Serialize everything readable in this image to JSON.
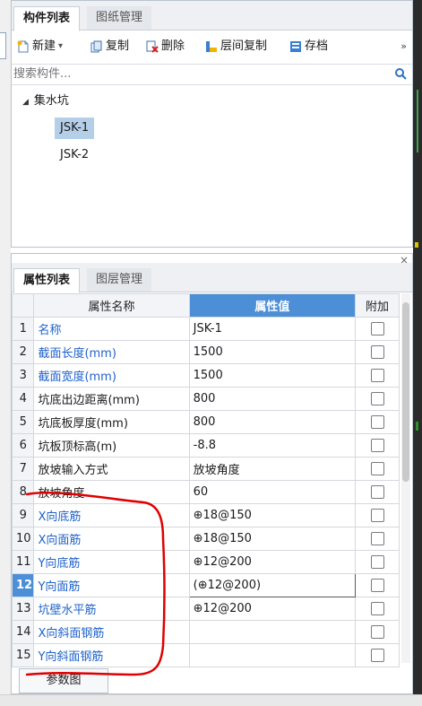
{
  "component_panel": {
    "tabs": [
      {
        "label": "构件列表",
        "active": true
      },
      {
        "label": "图纸管理",
        "active": false
      }
    ],
    "close_glyph": "×",
    "toolbar": {
      "new_label": "新建",
      "new_dropdown_glyph": "▾",
      "copy_label": "复制",
      "delete_label": "删除",
      "floor_copy_label": "层间复制",
      "archive_label": "存档",
      "overflow_glyph": "»"
    },
    "search": {
      "placeholder": "搜索构件..."
    },
    "tree": {
      "expand_glyph": "◢",
      "root_label": "集水坑",
      "children": [
        {
          "label": "JSK-1",
          "selected": true
        },
        {
          "label": "JSK-2",
          "selected": false
        }
      ]
    }
  },
  "property_panel": {
    "close_glyph": "×",
    "tabs": [
      {
        "label": "属性列表",
        "active": true
      },
      {
        "label": "图层管理",
        "active": false
      }
    ],
    "columns": [
      "属性名称",
      "属性值",
      "附加"
    ],
    "rows": [
      {
        "num": "1",
        "name": "名称",
        "value": "JSK-1",
        "blue": true
      },
      {
        "num": "2",
        "name": "截面长度(mm)",
        "value": "1500",
        "blue": true
      },
      {
        "num": "3",
        "name": "截面宽度(mm)",
        "value": "1500",
        "blue": true
      },
      {
        "num": "4",
        "name": "坑底出边距离(mm)",
        "value": "800",
        "blue": false
      },
      {
        "num": "5",
        "name": "坑底板厚度(mm)",
        "value": "800",
        "blue": false
      },
      {
        "num": "6",
        "name": "坑板顶标高(m)",
        "value": "-8.8",
        "blue": false
      },
      {
        "num": "7",
        "name": "放坡输入方式",
        "value": "放坡角度",
        "blue": false
      },
      {
        "num": "8",
        "name": "放坡角度",
        "value": "60",
        "blue": false
      },
      {
        "num": "9",
        "name": "X向底筋",
        "value": "⊕18@150",
        "blue": true
      },
      {
        "num": "10",
        "name": "X向面筋",
        "value": "⊕18@150",
        "blue": true
      },
      {
        "num": "11",
        "name": "Y向底筋",
        "value": "⊕12@200",
        "blue": true
      },
      {
        "num": "12",
        "name": "Y向面筋",
        "value": "(⊕12@200)",
        "blue": true,
        "active": true
      },
      {
        "num": "13",
        "name": "坑壁水平筋",
        "value": "⊕12@200",
        "blue": true
      },
      {
        "num": "14",
        "name": "X向斜面钢筋",
        "value": "",
        "blue": true
      },
      {
        "num": "15",
        "name": "Y向斜面钢筋",
        "value": "",
        "blue": true
      }
    ],
    "params_button": "参数图"
  },
  "colors": {
    "header_highlight": "#4d8fd6",
    "property_blue": "#1f62c9",
    "tree_selected": "#b6cfe8",
    "annotation_red": "#e00000"
  }
}
